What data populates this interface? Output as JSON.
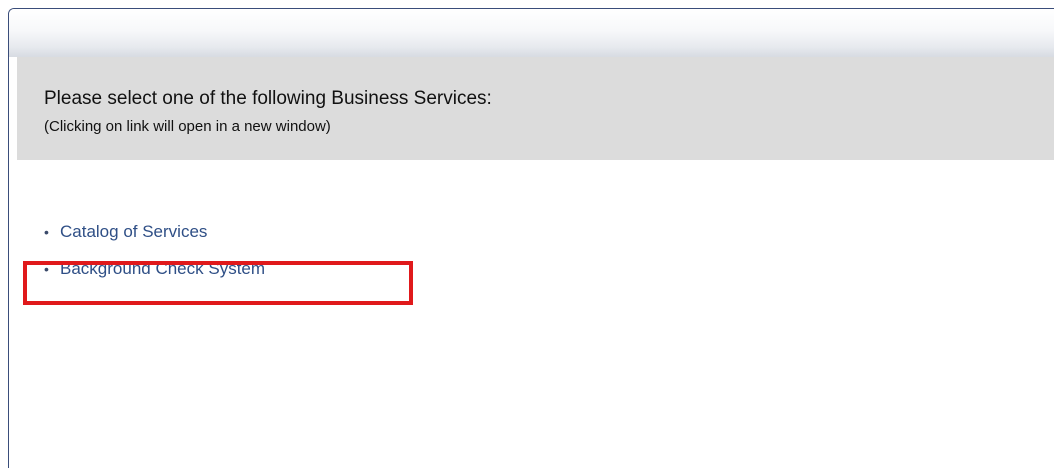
{
  "panel": {
    "title": "Please select one of the following Business Services:",
    "subtitle": "(Clicking on link will open in a new window)"
  },
  "services": [
    {
      "label": "Catalog of Services"
    },
    {
      "label": "Background Check System"
    }
  ],
  "bullet_glyph": "•",
  "colors": {
    "link": "#2f4f86",
    "panel_bg": "#dcdcdc",
    "frame_border": "#3a4d7a",
    "highlight": "#e0191b"
  }
}
